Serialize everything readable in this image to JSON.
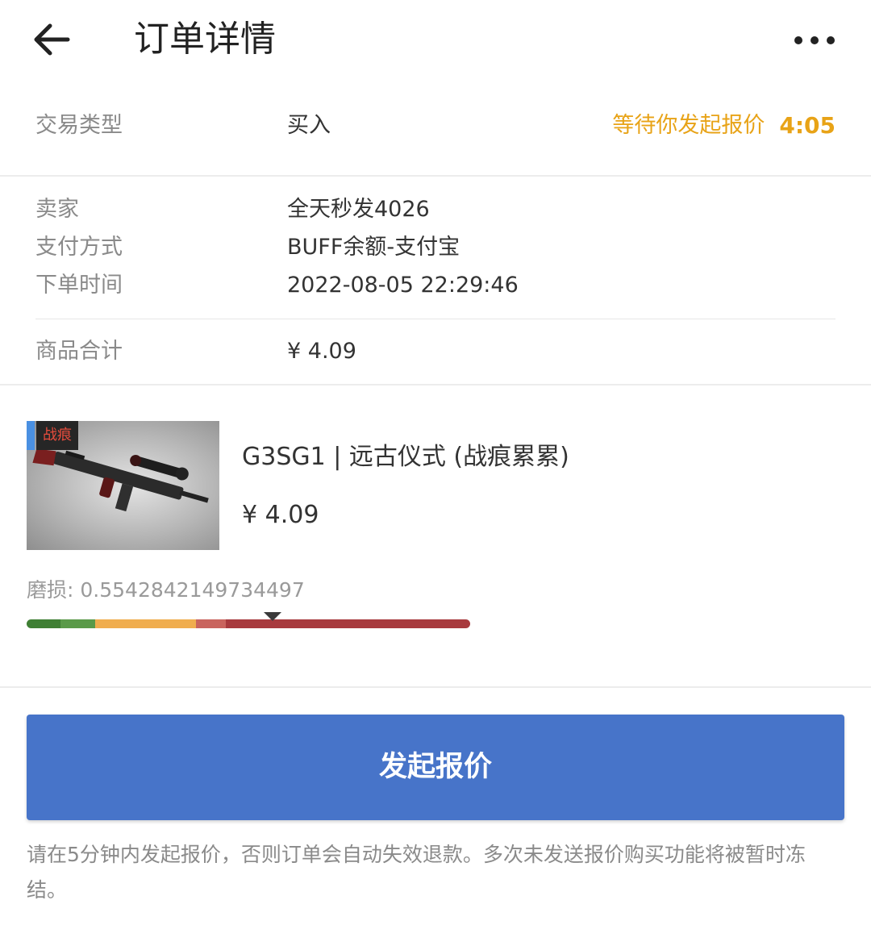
{
  "header": {
    "title": "订单详情",
    "back_icon": "arrow-left-icon",
    "more_icon": "more-horizontal-icon"
  },
  "trade": {
    "type_label": "交易类型",
    "type_value": "买入",
    "status_text": "等待你发起报价",
    "countdown": "4:05"
  },
  "details": {
    "seller_label": "卖家",
    "seller_value": "全天秒发4026",
    "payment_label": "支付方式",
    "payment_value": "BUFF余额-支付宝",
    "time_label": "下单时间",
    "time_value": "2022-08-05 22:29:46",
    "total_label": "商品合计",
    "total_value": "¥ 4.09"
  },
  "item": {
    "tag": "战痕",
    "name": "G3SG1 | 远古仪式 (战痕累累)",
    "price": "¥ 4.09",
    "wear_label": "磨损:",
    "wear_value": "0.5542842149734497",
    "wear_fraction": 0.5542842149734497
  },
  "action": {
    "button_label": "发起报价",
    "notice": "请在5分钟内发起报价，否则订单会自动失效退款。多次未发送报价购买功能将被暂时冻结。"
  },
  "colors": {
    "accent": "#4774c9",
    "status": "#e8a317",
    "wear_segments": [
      "#3f7f34",
      "#5a9a49",
      "#f0ad4e",
      "#c9645e",
      "#a83a3e"
    ]
  }
}
